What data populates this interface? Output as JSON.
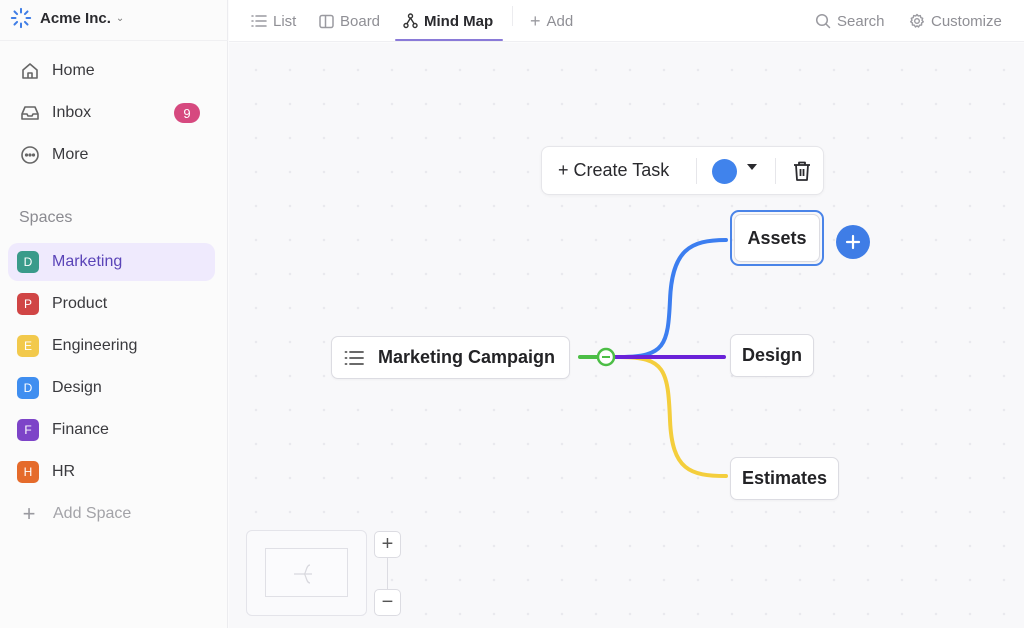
{
  "workspace": {
    "name": "Acme Inc.",
    "logo_icon": "spinner-burst-icon",
    "caret_icon": "chevron-down-icon"
  },
  "sidebar": {
    "nav": [
      {
        "label": "Home",
        "icon": "home-icon"
      },
      {
        "label": "Inbox",
        "icon": "inbox-icon",
        "badge": "9"
      },
      {
        "label": "More",
        "icon": "more-circle-icon"
      }
    ],
    "spaces_title": "Spaces",
    "spaces": [
      {
        "initial": "D",
        "label": "Marketing",
        "color": "#3a9b8a",
        "active": true
      },
      {
        "initial": "P",
        "label": "Product",
        "color": "#d04545"
      },
      {
        "initial": "E",
        "label": "Engineering",
        "color": "#f2c94c"
      },
      {
        "initial": "D",
        "label": "Design",
        "color": "#3f8ef0"
      },
      {
        "initial": "F",
        "label": "Finance",
        "color": "#7d44c8"
      },
      {
        "initial": "H",
        "label": "HR",
        "color": "#e56b2b"
      }
    ],
    "add_space": "Add Space"
  },
  "topbar": {
    "tabs": [
      {
        "label": "List",
        "icon": "list-icon"
      },
      {
        "label": "Board",
        "icon": "board-icon"
      },
      {
        "label": "Mind Map",
        "icon": "mind-map-icon",
        "active": true
      }
    ],
    "add_label": "Add",
    "search_label": "Search",
    "customize_label": "Customize"
  },
  "toolbar": {
    "create_task": "+ Create Task",
    "color": "#4083ec",
    "color_dropdown_icon": "caret-down-icon",
    "delete_icon": "trash-icon"
  },
  "mindmap": {
    "root": {
      "label": "Marketing Campaign",
      "icon": "list-icon",
      "collapse_icon": "minus-circle-icon",
      "color": "#4cbe46"
    },
    "children": [
      {
        "label": "Assets",
        "color": "#3c7ef0",
        "selected": true
      },
      {
        "label": "Design",
        "color": "#6a22d8"
      },
      {
        "label": "Estimates",
        "color": "#f4ce3c"
      }
    ],
    "add_child_icon": "plus-icon"
  },
  "controls": {
    "zoom_in": "+",
    "zoom_out": "−"
  },
  "accent": "#7b68d8"
}
